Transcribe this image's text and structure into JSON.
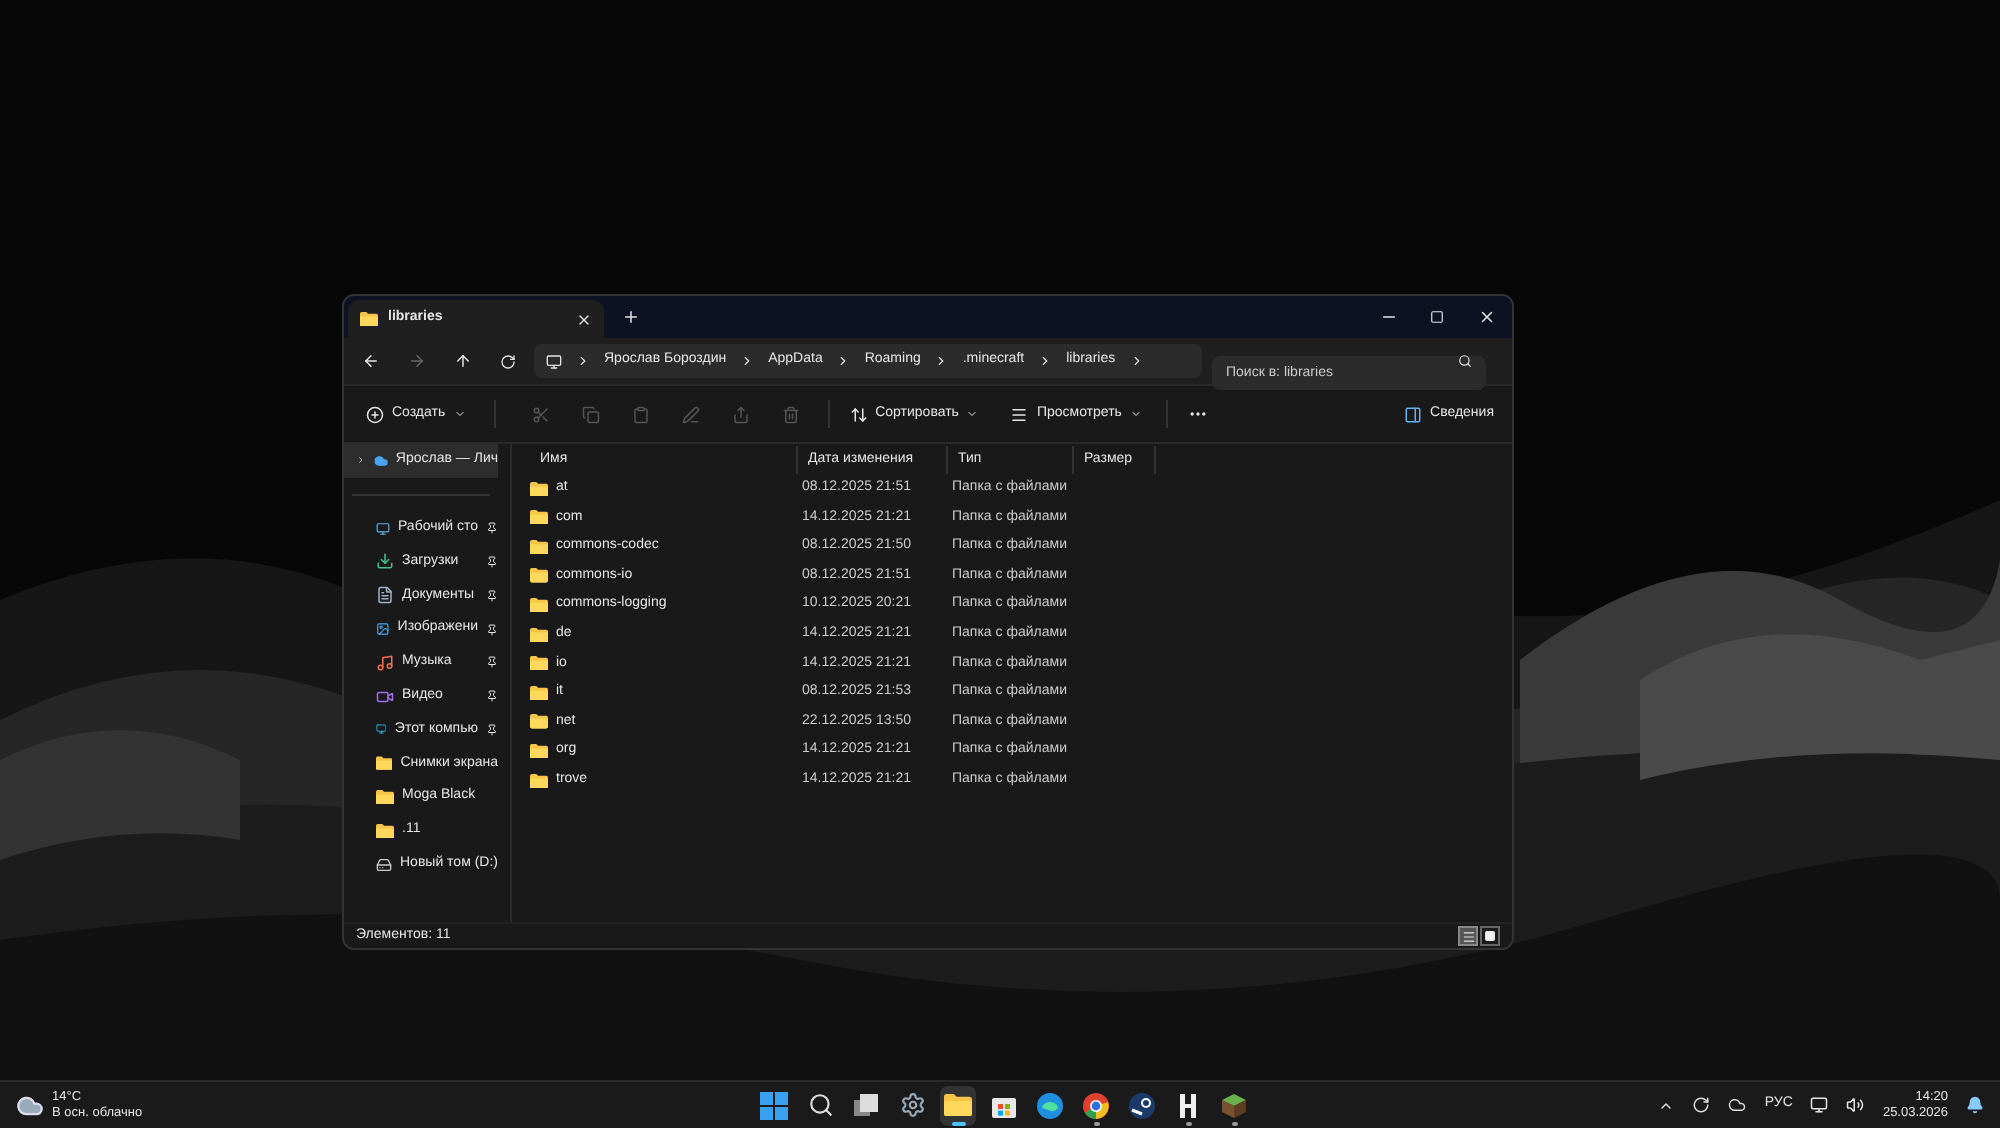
{
  "window": {
    "tab": {
      "title": "libraries"
    },
    "breadcrumb": [
      "Ярослав Бороздин",
      "AppData",
      "Roaming",
      ".minecraft",
      "libraries"
    ],
    "search": {
      "placeholder": "Поиск в: libraries"
    }
  },
  "toolbar": {
    "create": "Создать",
    "sort": "Сортировать",
    "view": "Просмотреть",
    "details": "Сведения"
  },
  "sidebar": {
    "items": [
      {
        "label": "Ярослав — Лич",
        "kind": "cloud",
        "pinned": false,
        "selected": true
      },
      {
        "label": "Рабочий сто",
        "kind": "desktop",
        "pinned": true,
        "selected": false
      },
      {
        "label": "Загрузки",
        "kind": "downloads",
        "pinned": true,
        "selected": false
      },
      {
        "label": "Документы",
        "kind": "documents",
        "pinned": true,
        "selected": false
      },
      {
        "label": "Изображени",
        "kind": "pictures",
        "pinned": true,
        "selected": false
      },
      {
        "label": "Музыка",
        "kind": "music",
        "pinned": true,
        "selected": false
      },
      {
        "label": "Видео",
        "kind": "video",
        "pinned": true,
        "selected": false
      },
      {
        "label": "Этот компью",
        "kind": "computer",
        "pinned": true,
        "selected": false
      },
      {
        "label": "Снимки экрана",
        "kind": "folder",
        "pinned": false,
        "selected": false
      },
      {
        "label": "Moga Black",
        "kind": "folder",
        "pinned": false,
        "selected": false
      },
      {
        "label": ".11",
        "kind": "folder",
        "pinned": false,
        "selected": false
      },
      {
        "label": "Новый том (D:)",
        "kind": "drive",
        "pinned": false,
        "selected": false
      }
    ]
  },
  "table": {
    "columns": [
      "Имя",
      "Дата изменения",
      "Тип",
      "Размер"
    ],
    "rows": [
      {
        "name": "at",
        "date": "08.12.2025 21:51",
        "type": "Папка с файлами"
      },
      {
        "name": "com",
        "date": "14.12.2025 21:21",
        "type": "Папка с файлами"
      },
      {
        "name": "commons-codec",
        "date": "08.12.2025 21:50",
        "type": "Папка с файлами"
      },
      {
        "name": "commons-io",
        "date": "08.12.2025 21:51",
        "type": "Папка с файлами"
      },
      {
        "name": "commons-logging",
        "date": "10.12.2025 20:21",
        "type": "Папка с файлами"
      },
      {
        "name": "de",
        "date": "14.12.2025 21:21",
        "type": "Папка с файлами"
      },
      {
        "name": "io",
        "date": "14.12.2025 21:21",
        "type": "Папка с файлами"
      },
      {
        "name": "it",
        "date": "08.12.2025 21:53",
        "type": "Папка с файлами"
      },
      {
        "name": "net",
        "date": "22.12.2025 13:50",
        "type": "Папка с файлами"
      },
      {
        "name": "org",
        "date": "14.12.2025 21:21",
        "type": "Папка с файлами"
      },
      {
        "name": "trove",
        "date": "14.12.2025 21:21",
        "type": "Папка с файлами"
      }
    ]
  },
  "status_bar": {
    "count": "Элементов: 11",
    "views": [
      {
        "kind": "details",
        "selected": true
      },
      {
        "kind": "tiles",
        "selected": false
      }
    ]
  },
  "taskbar": {
    "weather": {
      "temperature": "14°C",
      "condition": "В осн. облачно"
    },
    "apps": [
      {
        "kind": "start",
        "running": false,
        "selected": false
      },
      {
        "kind": "search",
        "running": false,
        "selected": false
      },
      {
        "kind": "taskview",
        "running": false,
        "selected": false
      },
      {
        "kind": "settings",
        "running": false,
        "selected": false
      },
      {
        "kind": "explorer",
        "running": true,
        "selected": true
      },
      {
        "kind": "store",
        "running": false,
        "selected": false
      },
      {
        "kind": "edge",
        "running": false,
        "selected": false
      },
      {
        "kind": "chrome",
        "running": true,
        "selected": false
      },
      {
        "kind": "steam",
        "running": false,
        "selected": false
      },
      {
        "kind": "hytale",
        "running": true,
        "selected": false
      },
      {
        "kind": "minecraft",
        "running": true,
        "selected": false
      }
    ],
    "tray": {
      "language": "РУС",
      "time": "14:20",
      "date": "25.03.2026"
    }
  }
}
